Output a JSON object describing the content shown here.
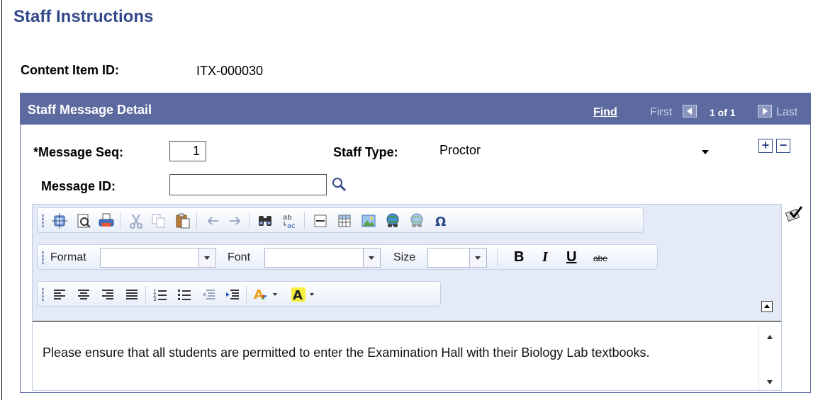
{
  "page": {
    "title": "Staff Instructions"
  },
  "content_item": {
    "label": "Content Item ID:",
    "value": "ITX-000030"
  },
  "panel": {
    "title": "Staff Message Detail",
    "find": "Find",
    "first": "First",
    "counter": "1 of 1",
    "last": "Last"
  },
  "form": {
    "message_seq_label": "*Message Seq:",
    "message_seq_value": "1",
    "staff_type_label": "Staff Type:",
    "staff_type_value": "Proctor",
    "message_id_label": "Message ID:",
    "message_id_value": "",
    "add_row": "+",
    "delete_row": "−"
  },
  "editor": {
    "format_label": "Format",
    "font_label": "Font",
    "size_label": "Size",
    "format_value": "",
    "font_value": "",
    "size_value": "",
    "bold": "B",
    "italic": "I",
    "underline": "U",
    "strike": "abe",
    "text_color": "A",
    "bg_color": "A",
    "toolbar1_icons": [
      "source-icon",
      "preview-icon",
      "print-icon",
      "cut-icon",
      "copy-icon",
      "paste-icon",
      "undo-icon",
      "redo-icon",
      "find-icon",
      "replace-icon",
      "horizontal-rule-icon",
      "table-icon",
      "image-icon",
      "link-icon",
      "unlink-icon",
      "special-char-icon"
    ],
    "toolbar3_icons": [
      "align-left-icon",
      "align-center-icon",
      "align-right-icon",
      "justify-icon",
      "numbered-list-icon",
      "bulleted-list-icon",
      "outdent-icon",
      "indent-icon",
      "text-color-icon",
      "bg-color-icon"
    ],
    "content": "Please ensure that all students are permitted to enter the Examination Hall with their Biology Lab textbooks."
  },
  "colors": {
    "title": "#34498b",
    "panel_header": "#5d6aa0",
    "toolbar_band": "#e4ebf7"
  }
}
